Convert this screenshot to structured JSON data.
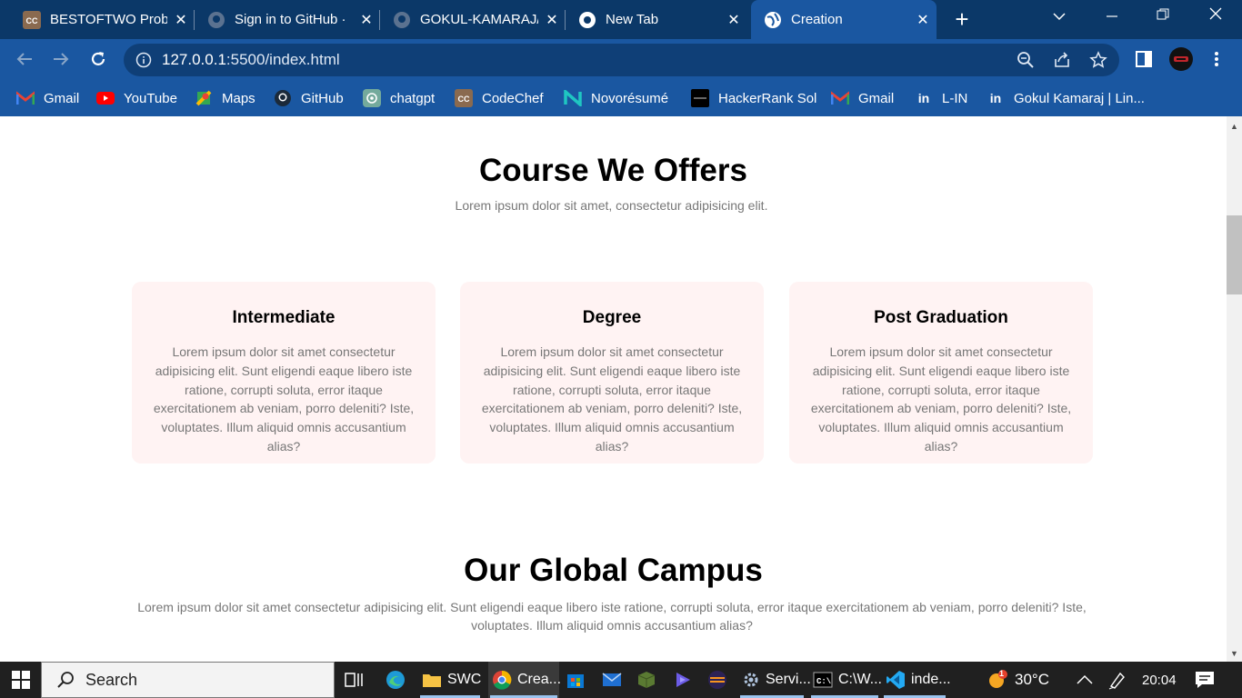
{
  "tabs": [
    {
      "title": "BESTOFTWO Probl",
      "icon": "codechef-icon",
      "active": false
    },
    {
      "title": "Sign in to GitHub ·",
      "icon": "github-icon",
      "active": false
    },
    {
      "title": "GOKUL-KAMARAJ/",
      "icon": "github-icon",
      "active": false
    },
    {
      "title": "New Tab",
      "icon": "chrome-icon",
      "active": false
    },
    {
      "title": "Creation",
      "icon": "globe-icon",
      "active": true
    }
  ],
  "address": {
    "host": "127.0.0.1",
    "path": ":5500/index.html"
  },
  "bookmarks": [
    {
      "label": "Gmail",
      "icon": "gmail-icon"
    },
    {
      "label": "YouTube",
      "icon": "youtube-icon"
    },
    {
      "label": "Maps",
      "icon": "maps-icon"
    },
    {
      "label": "GitHub",
      "icon": "github-icon"
    },
    {
      "label": "chatgpt",
      "icon": "chatgpt-icon"
    },
    {
      "label": "CodeChef",
      "icon": "codechef-icon"
    },
    {
      "label": "Novorésumé",
      "icon": "novoresume-icon"
    },
    {
      "label": "HackerRank Sol",
      "icon": "hackerrank-icon"
    },
    {
      "label": "Gmail",
      "icon": "gmail-icon"
    },
    {
      "label": "L-IN",
      "icon": "linkedin-icon"
    },
    {
      "label": "Gokul Kamaraj | Lin...",
      "icon": "linkedin-icon"
    }
  ],
  "course": {
    "title": "Course We Offers",
    "subtitle": "Lorem ipsum dolor sit amet, consectetur adipisicing elit.",
    "cards": [
      {
        "title": "Intermediate",
        "text": "Lorem ipsum dolor sit amet consectetur adipisicing elit. Sunt eligendi eaque libero iste ratione, corrupti soluta, error itaque exercitationem ab veniam, porro deleniti? Iste, voluptates. Illum aliquid omnis accusantium alias?"
      },
      {
        "title": "Degree",
        "text": "Lorem ipsum dolor sit amet consectetur adipisicing elit. Sunt eligendi eaque libero iste ratione, corrupti soluta, error itaque exercitationem ab veniam, porro deleniti? Iste, voluptates. Illum aliquid omnis accusantium alias?"
      },
      {
        "title": "Post Graduation",
        "text": "Lorem ipsum dolor sit amet consectetur adipisicing elit. Sunt eligendi eaque libero iste ratione, corrupti soluta, error itaque exercitationem ab veniam, porro deleniti? Iste, voluptates. Illum aliquid omnis accusantium alias?"
      }
    ]
  },
  "campus": {
    "title": "Our Global Campus",
    "subtitle": "Lorem ipsum dolor sit amet consectetur adipisicing elit. Sunt eligendi eaque libero iste ratione, corrupti soluta, error itaque exercitationem ab veniam, porro deleniti? Iste, voluptates. Illum aliquid omnis accusantium alias?"
  },
  "taskbar": {
    "search_label": "Search",
    "items": [
      {
        "label": "SWC",
        "icon": "folder-icon"
      },
      {
        "label": "Crea...",
        "icon": "chrome-icon"
      },
      {
        "label": "Servi...",
        "icon": "services-gear-icon"
      },
      {
        "label": "C:\\W...",
        "icon": "cmd-icon"
      },
      {
        "label": "inde...",
        "icon": "vscode-icon"
      }
    ],
    "weather": "30°C",
    "weather_badge": "1",
    "time": "20:04"
  }
}
